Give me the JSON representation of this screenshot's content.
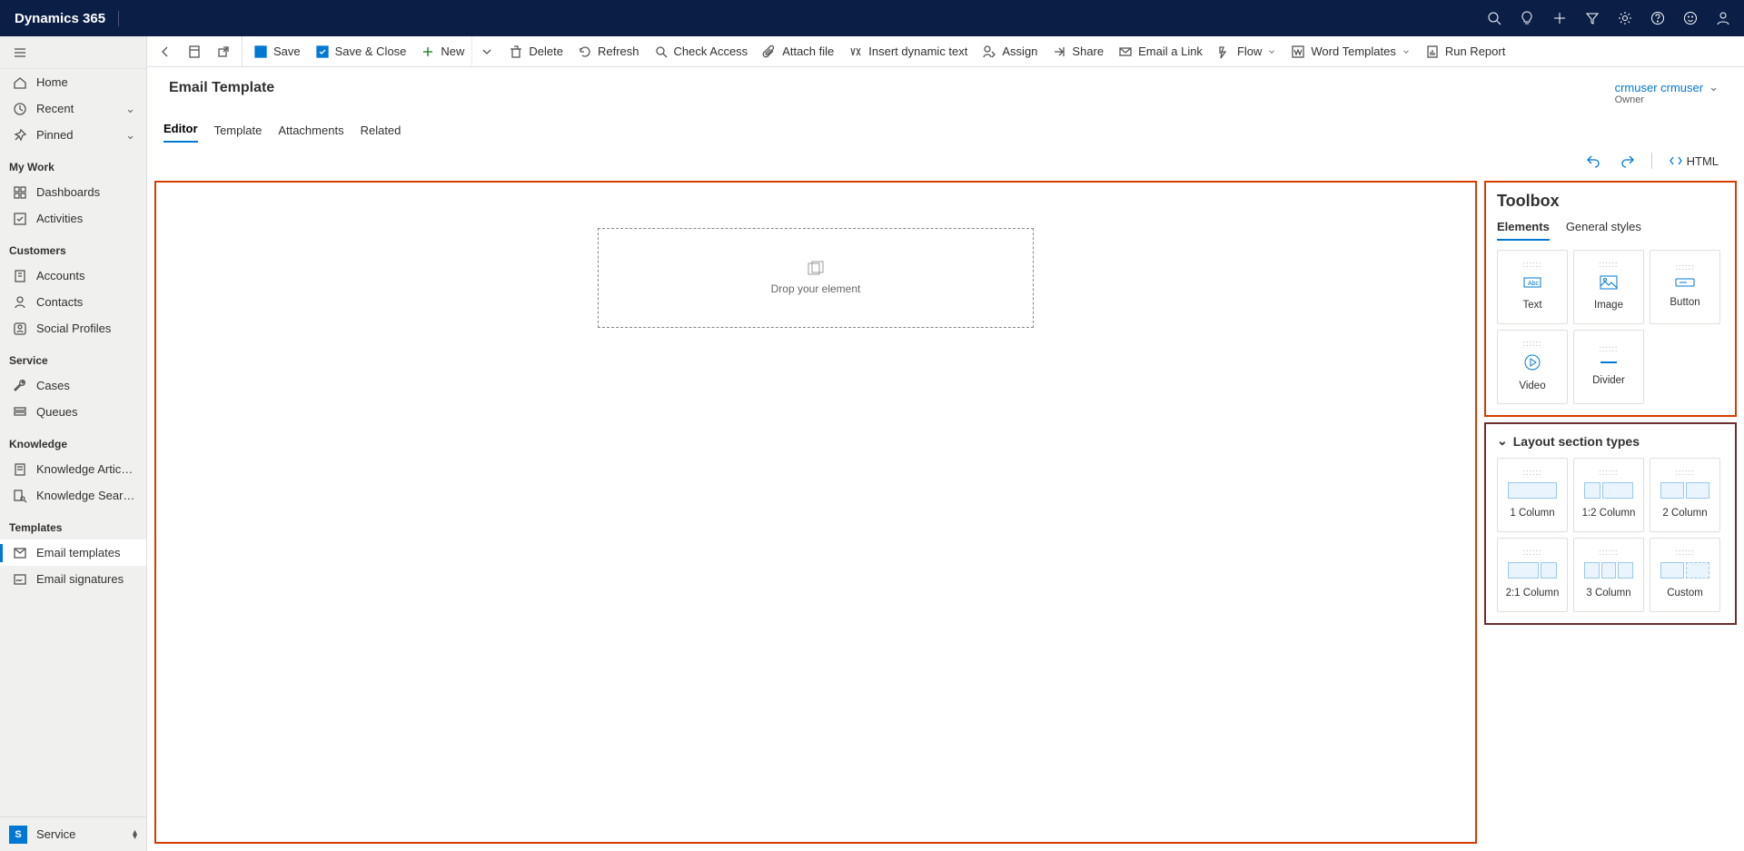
{
  "brand": "Dynamics 365",
  "sidebar": {
    "global": [
      {
        "icon": "home",
        "label": "Home"
      },
      {
        "icon": "clock",
        "label": "Recent",
        "expand": true
      },
      {
        "icon": "pin",
        "label": "Pinned",
        "expand": true
      }
    ],
    "sections": [
      {
        "title": "My Work",
        "items": [
          {
            "icon": "dash",
            "label": "Dashboards"
          },
          {
            "icon": "check",
            "label": "Activities"
          }
        ]
      },
      {
        "title": "Customers",
        "items": [
          {
            "icon": "building",
            "label": "Accounts"
          },
          {
            "icon": "person",
            "label": "Contacts"
          },
          {
            "icon": "profile",
            "label": "Social Profiles"
          }
        ]
      },
      {
        "title": "Service",
        "items": [
          {
            "icon": "wrench",
            "label": "Cases"
          },
          {
            "icon": "queue",
            "label": "Queues"
          }
        ]
      },
      {
        "title": "Knowledge",
        "items": [
          {
            "icon": "book",
            "label": "Knowledge Articles"
          },
          {
            "icon": "booksearch",
            "label": "Knowledge Search"
          }
        ]
      },
      {
        "title": "Templates",
        "items": [
          {
            "icon": "template",
            "label": "Email templates",
            "active": true
          },
          {
            "icon": "sig",
            "label": "Email signatures"
          }
        ]
      }
    ],
    "area": {
      "badge": "S",
      "label": "Service"
    }
  },
  "commands": {
    "back": "Back",
    "panel": "Panel",
    "popout": "Pop out",
    "save": "Save",
    "saveClose": "Save & Close",
    "new": "New",
    "delete": "Delete",
    "refresh": "Refresh",
    "checkAccess": "Check Access",
    "attach": "Attach file",
    "dynamic": "Insert dynamic text",
    "assign": "Assign",
    "share": "Share",
    "emailLink": "Email a Link",
    "flow": "Flow",
    "wordTemplates": "Word Templates",
    "runReport": "Run Report"
  },
  "record": {
    "title": "Email Template",
    "owner": {
      "value": "crmuser crmuser",
      "label": "Owner"
    }
  },
  "tabs": [
    "Editor",
    "Template",
    "Attachments",
    "Related"
  ],
  "editorToolbar": {
    "html": "HTML"
  },
  "canvas": {
    "drop": "Drop your element"
  },
  "toolbox": {
    "title": "Toolbox",
    "tabs": [
      "Elements",
      "General styles"
    ],
    "elements": [
      "Text",
      "Image",
      "Button",
      "Video",
      "Divider"
    ],
    "layoutTitle": "Layout section types",
    "layouts": [
      "1 Column",
      "1:2 Column",
      "2 Column",
      "2:1 Column",
      "3 Column",
      "Custom"
    ]
  }
}
